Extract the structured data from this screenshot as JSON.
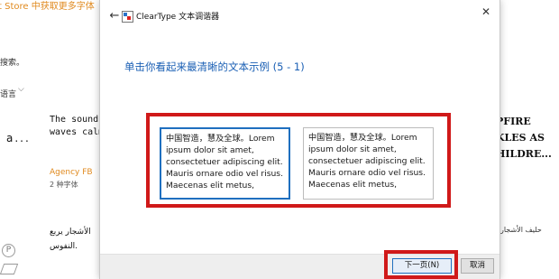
{
  "background": {
    "top_text": "t Store 中获取更多字体",
    "search_placeholder": "搜索。",
    "language_label": "语言",
    "sample_text": "The sound of\nwaves calms",
    "glyph_text": "a...",
    "font_name": "Agency FB",
    "font_count": "2 种字体",
    "arabic_line1": "الأشجار يربع",
    "arabic_line2": "النفوس.",
    "p_icon_label": "P",
    "right_sample": "PFIRE\nKLES AS\nHILDRE...",
    "right_arabic": "حليف الأشجار"
  },
  "dialog": {
    "title": "ClearType 文本调谐器",
    "heading": "单击你看起来最清晰的文本示例 (5 - 1)",
    "samples": [
      {
        "text": "中国智造，慧及全球。Lorem ipsum dolor sit amet, consectetuer adipiscing elit. Mauris ornare odio vel risus. Maecenas elit metus,"
      },
      {
        "text": "中国智造，慧及全球。Lorem ipsum dolor sit amet, consectetuer adipiscing elit. Mauris ornare odio vel risus. Maecenas elit metus,"
      }
    ],
    "next_button": "下一页(N)",
    "cancel_button": "取消",
    "close_symbol": "✕",
    "back_symbol": "←"
  },
  "colors": {
    "highlight": "#d01919",
    "accent": "#1f6fbf",
    "heading": "#1a5fb4",
    "font_name": "#e08a1f"
  }
}
